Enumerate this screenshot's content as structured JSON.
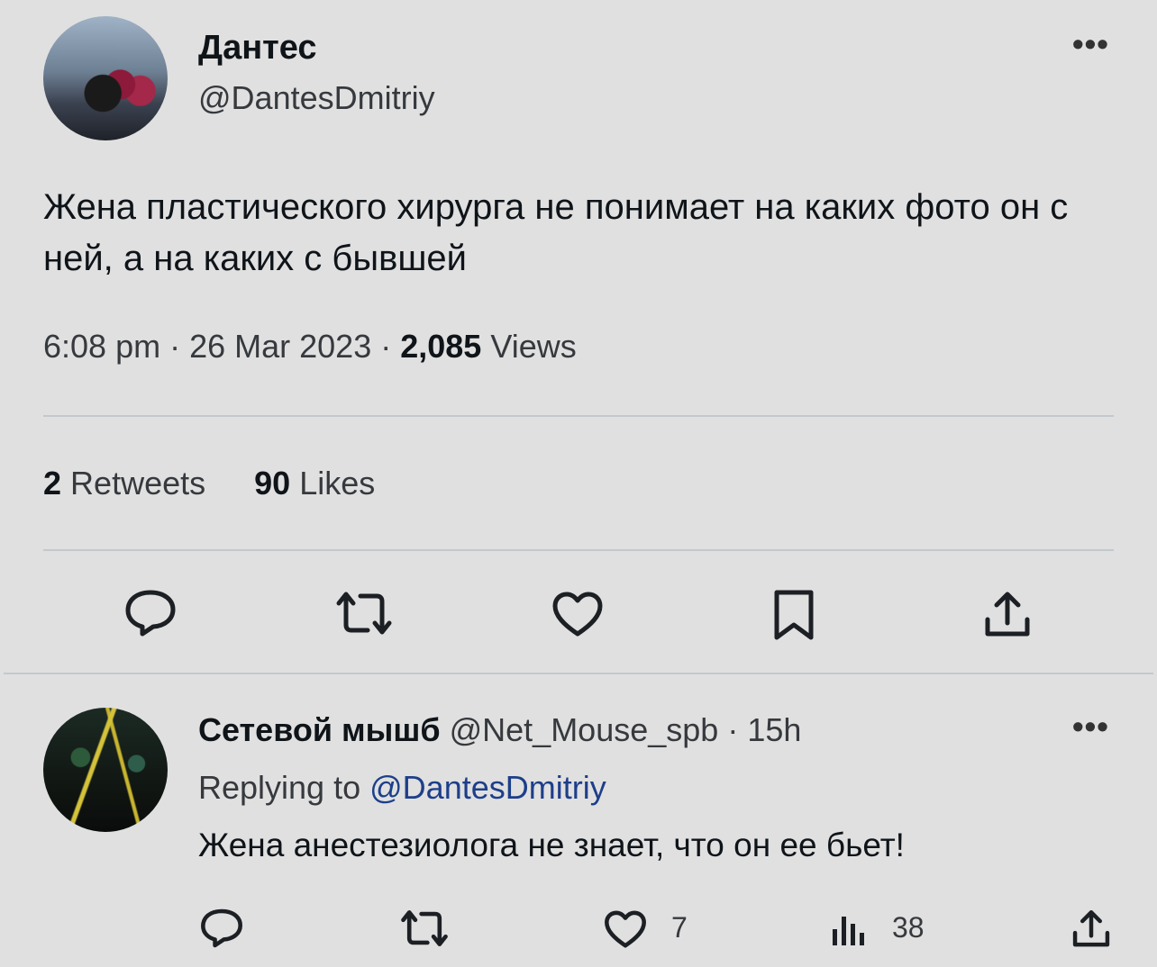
{
  "tweet": {
    "author_name": "Дантес",
    "author_handle": "@DantesDmitriy",
    "more_label": "•••",
    "text": "Жена пластического хирурга не понимает на каких фото он с ней, а на каких с бывшей",
    "time": "6:08 pm",
    "date": "26 Mar 2023",
    "views_count": "2,085",
    "views_label": "Views",
    "retweets_count": "2",
    "retweets_label": "Retweets",
    "likes_count": "90",
    "likes_label": "Likes",
    "actions": [
      "reply-icon",
      "retweet-icon",
      "like-icon",
      "bookmark-icon",
      "share-icon"
    ]
  },
  "reply": {
    "author_name": "Сетевой мышб",
    "author_handle": "@Net_Mouse_spb",
    "age": "15h",
    "more_label": "•••",
    "replying_prefix": "Replying to",
    "replying_handle": "@DantesDmitriy",
    "text": "Жена анестезиолога не знает, что он ее бьет!",
    "likes_count": "7",
    "views_count": "38",
    "actions": [
      "reply-icon",
      "retweet-icon",
      "like-icon",
      "views-icon",
      "share-icon"
    ]
  },
  "colors": {
    "background": "#e0e0e0",
    "text": "#0f1419",
    "secondary": "#36393d",
    "link": "#1d3f8a",
    "divider": "#c3c9cd"
  }
}
